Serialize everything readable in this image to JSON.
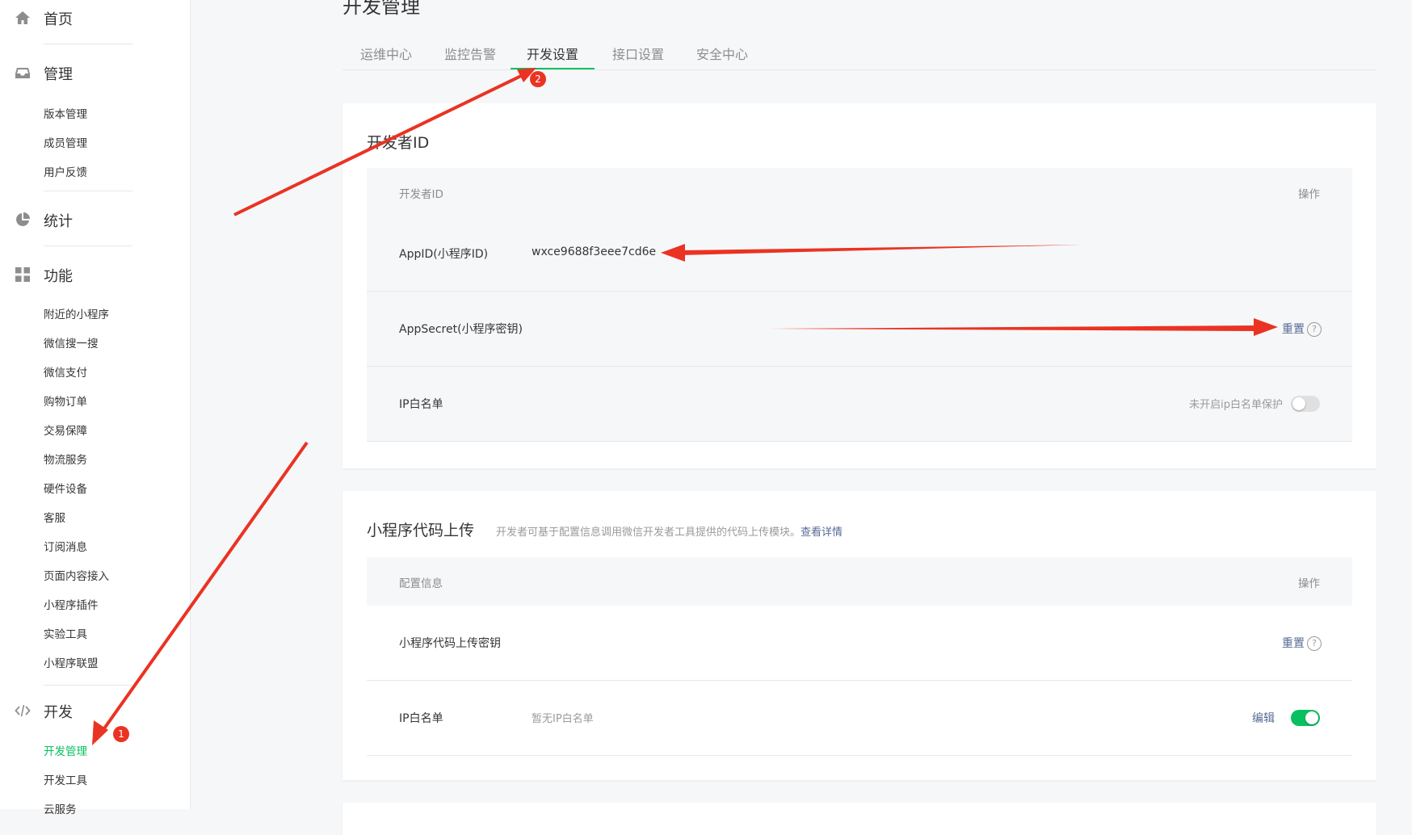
{
  "sidebar": {
    "home": {
      "label": "首页",
      "icon": "home-icon"
    },
    "manage": {
      "label": "管理",
      "icon": "inbox-icon",
      "items": [
        "版本管理",
        "成员管理",
        "用户反馈"
      ]
    },
    "stats": {
      "label": "统计",
      "icon": "pie-chart-icon"
    },
    "features": {
      "label": "功能",
      "icon": "grid-icon",
      "items": [
        "附近的小程序",
        "微信搜一搜",
        "微信支付",
        "购物订单",
        "交易保障",
        "物流服务",
        "硬件设备",
        "客服",
        "订阅消息",
        "页面内容接入",
        "小程序插件",
        "实验工具",
        "小程序联盟"
      ]
    },
    "dev": {
      "label": "开发",
      "icon": "code-icon",
      "items": [
        "开发管理",
        "开发工具",
        "云服务"
      ],
      "active_item": "开发管理"
    }
  },
  "page": {
    "title": "开发管理"
  },
  "tabs": [
    {
      "label": "运维中心",
      "active": false
    },
    {
      "label": "监控告警",
      "active": false
    },
    {
      "label": "开发设置",
      "active": true
    },
    {
      "label": "接口设置",
      "active": false
    },
    {
      "label": "安全中心",
      "active": false
    }
  ],
  "developer_id": {
    "title": "开发者ID",
    "col_left": "开发者ID",
    "col_right": "操作",
    "appid_label": "AppID(小程序ID)",
    "appid_value": "wxce9688f3eee7cd6e",
    "secret_label": "AppSecret(小程序密钥)",
    "secret_action": "重置",
    "ip_label": "IP白名单",
    "ip_status": "未开启ip白名单保护",
    "ip_switch_on": false
  },
  "code_upload": {
    "title": "小程序代码上传",
    "desc": "开发者可基于配置信息调用微信开发者工具提供的代码上传模块。",
    "desc_link": "查看详情",
    "col_left": "配置信息",
    "col_right": "操作",
    "key_label": "小程序代码上传密钥",
    "key_action": "重置",
    "ip_label": "IP白名单",
    "ip_value": "暂无IP白名单",
    "ip_action": "编辑",
    "ip_switch_on": true
  },
  "annotations": {
    "badge_1": "1",
    "badge_2": "2"
  },
  "colors": {
    "accent": "#07c160",
    "link": "#576b95",
    "arrow": "#ea3323"
  }
}
